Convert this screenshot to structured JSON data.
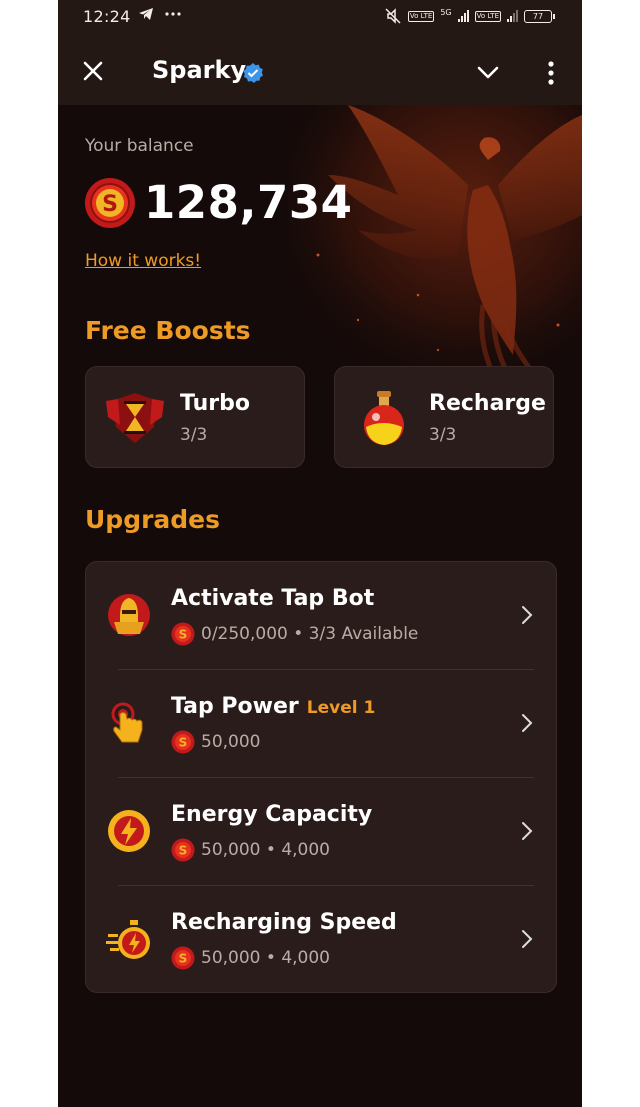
{
  "status_bar": {
    "time": "12:24",
    "left_icons": [
      "telegram-icon",
      "more-dots-icon"
    ],
    "network_tag_1": "Vo LTE",
    "network_tag_2": "5G",
    "network_tag_3": "Vo LTE",
    "battery": "77"
  },
  "header": {
    "title": "Sparky",
    "verified": true
  },
  "balance": {
    "label": "Your balance",
    "value": "128,734",
    "coin_symbol": "S",
    "how_link": "How it works!"
  },
  "free_boosts": {
    "title": "Free Boosts",
    "items": [
      {
        "name": "Turbo",
        "count": "3/3",
        "icon": "hourglass-shield-icon"
      },
      {
        "name": "Recharge",
        "count": "3/3",
        "icon": "potion-icon"
      }
    ]
  },
  "upgrades": {
    "title": "Upgrades",
    "items": [
      {
        "name": "Activate Tap Bot",
        "level": "",
        "sub": "0/250,000 • 3/3 Available",
        "icon": "helmet-icon"
      },
      {
        "name": "Tap Power",
        "level": "Level 1",
        "sub": "50,000",
        "icon": "tap-hand-icon"
      },
      {
        "name": "Energy Capacity",
        "level": "",
        "sub": "50,000 • 4,000",
        "icon": "lightning-icon"
      },
      {
        "name": "Recharging Speed",
        "level": "",
        "sub": "50,000 • 4,000",
        "icon": "stopwatch-icon"
      }
    ]
  },
  "colors": {
    "accent": "#ee9b26",
    "background": "#140a09",
    "card": "#2a1c1a",
    "muted_text": "#b9aca6"
  }
}
